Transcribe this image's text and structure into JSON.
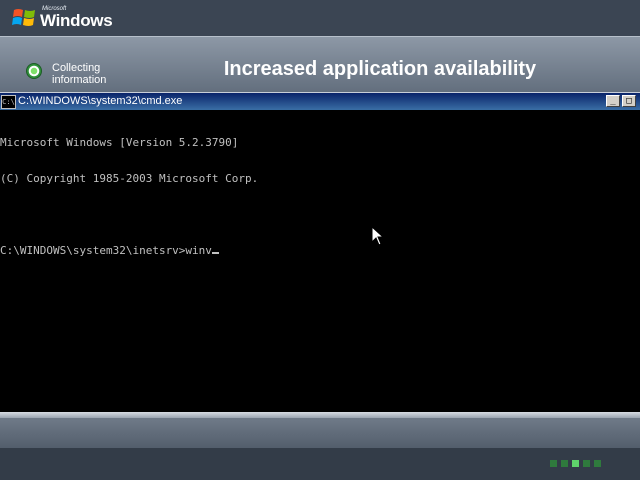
{
  "branding": {
    "small_text": "Microsoft",
    "product_name": "Windows",
    "flag_icon": "windows-flag-icon"
  },
  "setup": {
    "current_step_label": "Collecting information",
    "banner": "Increased application availability",
    "step_icon": "step-active-icon"
  },
  "cmd_window": {
    "title": "C:\\WINDOWS\\system32\\cmd.exe",
    "title_icon_text": "C:\\",
    "minimize_label": "_",
    "maximize_label": "□",
    "lines": [
      "Microsoft Windows [Version 5.2.3790]",
      "(C) Copyright 1985-2003 Microsoft Corp.",
      "",
      "C:\\WINDOWS\\system32\\inetsrv>winv"
    ]
  },
  "progress": {
    "total_segments": 5,
    "active_segment": 3
  },
  "colors": {
    "console_bg": "#000000",
    "console_text": "#c0c0c0",
    "title_bar_start": "#0a246a",
    "title_bar_end": "#3a6ea5",
    "progress_active": "#5fd36b",
    "progress_inactive": "#2f7a3d"
  }
}
